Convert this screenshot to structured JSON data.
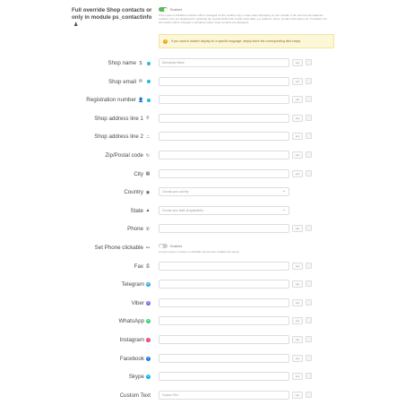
{
  "override": {
    "label": "Full override Shop contacts or only in module ps_contactinfo",
    "toggle_text": "Enabled",
    "help": "If the option is disabled contacts will be managed via the module only, in case when displaying of your module. If the new text and data are enabled, they are displayed for replacing the module fields that contain shop data, e.g. address, name, contact information etc. If enabled, the information will be changed in all places where shop contacts are displayed.",
    "alert": "If you want to disable display for a specific language, simply leave the corresponding field empty."
  },
  "colors": {
    "accent": "#25b9d7",
    "toggle_on": "#5cb85c",
    "alert_bg": "#fcf8d7"
  },
  "lang_btn": "en",
  "fields": [
    {
      "label": "Shop name",
      "icon": "$",
      "dot": true,
      "value": "Demoshop Name",
      "kind": "text"
    },
    {
      "label": "Shop email",
      "icon": "✉",
      "dot": true,
      "value": "",
      "kind": "text"
    },
    {
      "label": "Registration number",
      "icon": "👤",
      "dot": true,
      "value": "",
      "kind": "text"
    },
    {
      "label": "Shop address line 1",
      "icon": "⚲",
      "dot": false,
      "value": "",
      "kind": "text"
    },
    {
      "label": "Shop address line 2",
      "icon": "⛬",
      "dot": false,
      "value": "",
      "kind": "text"
    },
    {
      "label": "Zip/Postal code",
      "icon": "↻",
      "dot": false,
      "value": "",
      "kind": "text"
    },
    {
      "label": "City",
      "icon": "▦",
      "dot": false,
      "value": "",
      "kind": "text"
    },
    {
      "label": "Country",
      "icon": "◉",
      "dot": false,
      "value": "Choose your country",
      "kind": "select"
    },
    {
      "label": "State",
      "icon": "▲",
      "dot": false,
      "value": "Choose your state (if applicable)",
      "kind": "select"
    },
    {
      "label": "Phone",
      "icon": "✆",
      "dot": false,
      "value": "",
      "kind": "text"
    },
    {
      "label": "Set Phone clickable",
      "icon": "⚯",
      "dot": false,
      "value": "Enabled",
      "kind": "toggle",
      "help": "Convert phone numbers to clickable phone links. Disable this option."
    },
    {
      "label": "Fax",
      "icon": "⎙",
      "dot": false,
      "value": "",
      "kind": "text"
    },
    {
      "label": "Telegram",
      "icon": "➤",
      "dot": false,
      "value": "",
      "kind": "text",
      "circ": "#2ca5e0"
    },
    {
      "label": "Viber",
      "icon": "✆",
      "dot": false,
      "value": "",
      "kind": "text",
      "circ": "#7360f2"
    },
    {
      "label": "WhatsApp",
      "icon": "✆",
      "dot": false,
      "value": "",
      "kind": "text",
      "circ": "#25d366"
    },
    {
      "label": "Instagram",
      "icon": "◎",
      "dot": false,
      "value": "",
      "kind": "text",
      "circ": "#e1306c"
    },
    {
      "label": "Facebook",
      "icon": "f",
      "dot": false,
      "value": "",
      "kind": "text",
      "circ": "#1877f2"
    },
    {
      "label": "Skype",
      "icon": "S",
      "dot": false,
      "value": "",
      "kind": "text",
      "circ": "#00aff0"
    },
    {
      "label": "Custom Text",
      "icon": "",
      "dot": false,
      "value": "Custom Text",
      "kind": "text"
    }
  ]
}
